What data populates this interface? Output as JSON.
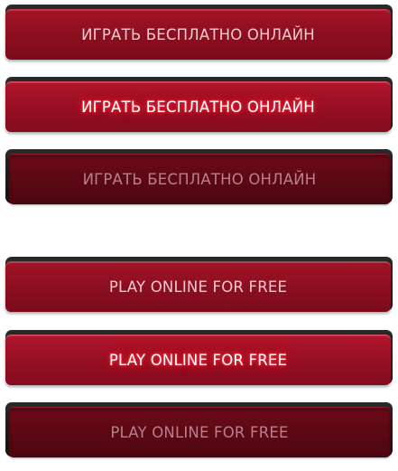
{
  "buttons_ru": {
    "normal_label": "ИГРАТЬ БЕСПЛАТНО ОНЛАЙН",
    "hover_label": "ИГРАТЬ БЕСПЛАТНО ОНЛАЙН",
    "pressed_label": "ИГРАТЬ БЕСПЛАТНО ОНЛАЙН"
  },
  "buttons_en": {
    "normal_label": "PLAY ONLINE FOR FREE",
    "hover_label": "PLAY ONLINE FOR FREE",
    "pressed_label": "PLAY ONLINE FOR FREE"
  },
  "colors": {
    "button_red": "#8e0f20",
    "button_red_hover": "#9a1024",
    "button_red_pressed": "#5c0814",
    "back_plate": "#1c1c1c",
    "label_normal": "#f2c9cf",
    "label_hover": "#ffffff",
    "label_pressed": "#b8808a"
  }
}
